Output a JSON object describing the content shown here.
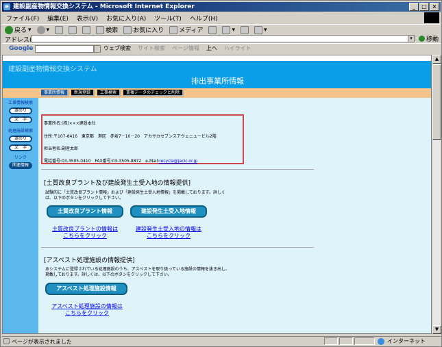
{
  "window": {
    "title": "建設副産物情報交換システム - Microsoft Internet Explorer"
  },
  "menu": [
    "ファイル(F)",
    "編集(E)",
    "表示(V)",
    "お気に入り(A)",
    "ツール(T)",
    "ヘルプ(H)"
  ],
  "toolbar": {
    "back": "戻る",
    "search": "検索",
    "favorites": "お気に入り",
    "media": "メディア"
  },
  "address": {
    "label": "アドレス(D)",
    "go": "移動",
    "value": ""
  },
  "googlebar": {
    "logo": "Google",
    "web_search": "ウェブ検索",
    "site_search": "サイト検索",
    "page_info": "ページ情報",
    "up": "上へ",
    "highlight": "ハイライト"
  },
  "site": {
    "name": "建設副産物情報交換システム",
    "heading": "排出事業所情報"
  },
  "tabs": [
    "事業所情報",
    "新規登録",
    "工事検索",
    "重複データのチェックと削除"
  ],
  "sidebar": {
    "construction_search": "工事情報検索",
    "btn_route": "道のり",
    "btn_text": "文　字",
    "processing_search": "処理施設検索",
    "link_label": "リンク",
    "related": "関連情報"
  },
  "office": {
    "name": "事業所名:(株)×××建設本社",
    "address": "住所:〒107-8416　東京都　港区　赤坂7－10－20　アカサカセブンスアヴェニュービル2階",
    "contact": "担当者名:副産太郎",
    "phone_fax": "電話番号:03-3505-0410　FAX番号:03-3505-8872　e-Mail:",
    "email": "recycle@jacic.or.jp"
  },
  "section1": {
    "title": "[土質改良プラント及び建設発生土受入地の情報提供]",
    "desc": "試験的に「土質改良プラント情報」および「建設発生土受入地情報」を掲載しております。詳しくは、以下のボタンをクリックして下さい。",
    "btn_plant": "土質改良プラント情報",
    "btn_soil": "建設発生土受入地情報",
    "link_plant_1": "土質改良プラントの情報は",
    "link_plant_2": "こちらをクリック",
    "link_soil_1": "建設発生土受入地の情報は",
    "link_soil_2": "こちらをクリック"
  },
  "section2": {
    "title": "[アスベスト処理施設の情報提供]",
    "desc": "本システムに登録されている処理施設のうち、アスベストを取り扱っている施設の情報を抜き出し、掲載しております。詳しくは、以下のボタンをクリックして下さい。",
    "btn": "アスベスト処理施設情報",
    "link_1": "アスベスト処理施設の情報は",
    "link_2": "こちらをクリック"
  },
  "status": {
    "text": "ページが表示されました",
    "zone": "インターネット"
  }
}
